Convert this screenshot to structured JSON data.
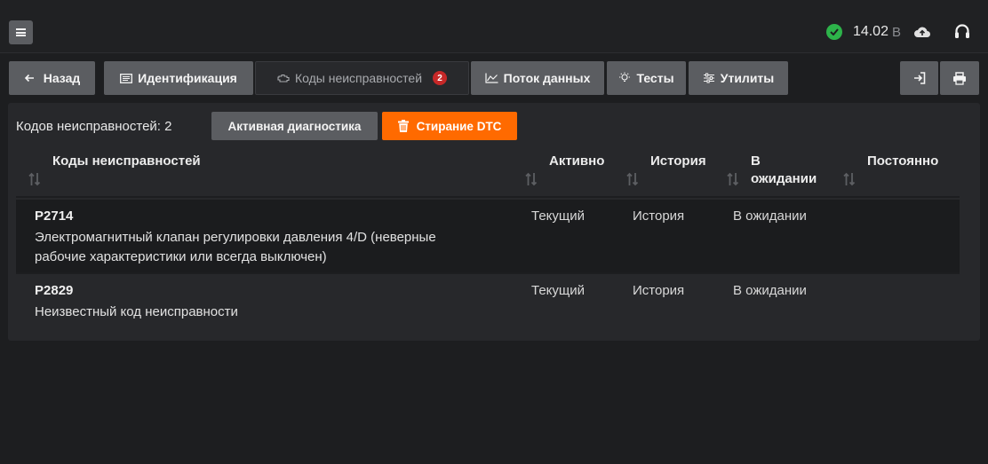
{
  "header": {
    "voltage": "14.02",
    "voltage_unit": "В",
    "status_color": "#2db34a"
  },
  "toolbar": {
    "back_label": "Назад",
    "identification_label": "Идентификация",
    "dtc_label": "Коды неисправностей",
    "dtc_badge": "2",
    "datastream_label": "Поток данных",
    "tests_label": "Тесты",
    "utilities_label": "Утилиты"
  },
  "panel": {
    "summary": "Кодов неисправностей: 2",
    "active_diag_label": "Активная диагностика",
    "clear_dtc_label": "Стирание DTC",
    "clear_color": "#ff6a00"
  },
  "table": {
    "columns": {
      "codes": "Коды неисправностей",
      "active": "Активно",
      "history": "История",
      "pending_line1": "В",
      "pending_line2": "ожидании",
      "permanent": "Постоянно"
    },
    "rows": [
      {
        "code": "P2714",
        "desc_line1": "Электромагнитный клапан регулировки давления 4/D (неверные",
        "desc_line2": "рабочие характеристики или всегда выключен)",
        "active": "Текущий",
        "history": "История",
        "pending": "В ожидании",
        "permanent": ""
      },
      {
        "code": "P2829",
        "desc_line1": "Неизвестный код неисправности",
        "desc_line2": "",
        "active": "Текущий",
        "history": "История",
        "pending": "В ожидании",
        "permanent": ""
      }
    ]
  }
}
